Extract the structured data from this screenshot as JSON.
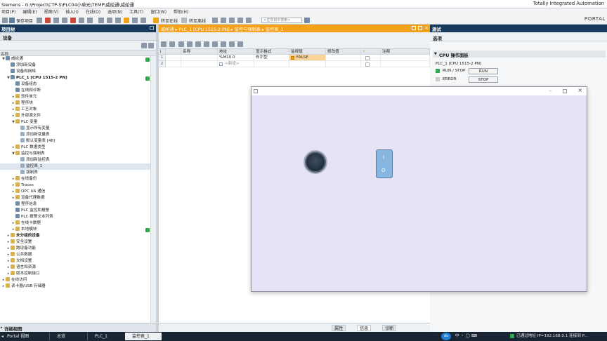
{
  "app": {
    "title": "Siemens  -  G:\\Project\\CTP-S\\PLC04小单元\\TEMP\\威纶通\\威纶通",
    "brand_line1": "Totally Integrated Automation",
    "brand_line2": "PORTAL"
  },
  "menu": [
    "项目(P)",
    "编辑(E)",
    "视图(V)",
    "插入(I)",
    "在线(O)",
    "选项(N)",
    "工具(T)",
    "窗口(W)",
    "帮助(H)"
  ],
  "toolbar": {
    "save_label": "保存项目",
    "go_online": "转至在线",
    "go_offline": "转至离线",
    "search_placeholder": "<在项目中搜索>"
  },
  "left_panel": {
    "title": "项目树",
    "subtitle": "设备",
    "column_name": "名称",
    "tree": [
      {
        "label": "威纶通",
        "indent": 0,
        "twisty": "▼",
        "icon": "project",
        "bold": false
      },
      {
        "label": "添加新设备",
        "indent": 1,
        "twisty": "",
        "icon": "item",
        "bold": false
      },
      {
        "label": "设备和网络",
        "indent": 1,
        "twisty": "",
        "icon": "item",
        "bold": false
      },
      {
        "label": "PLC_1 [CPU 1515-2 PN]",
        "indent": 1,
        "twisty": "▼",
        "icon": "cpu",
        "bold": true
      },
      {
        "label": "设备组态",
        "indent": 2,
        "twisty": "",
        "icon": "item",
        "bold": false
      },
      {
        "label": "在线和诊断",
        "indent": 2,
        "twisty": "",
        "icon": "item",
        "bold": false
      },
      {
        "label": "软件单元",
        "indent": 2,
        "twisty": "▸",
        "icon": "folder",
        "bold": false
      },
      {
        "label": "程序块",
        "indent": 2,
        "twisty": "▸",
        "icon": "folder",
        "bold": false
      },
      {
        "label": "工艺对象",
        "indent": 2,
        "twisty": "▸",
        "icon": "folder",
        "bold": false
      },
      {
        "label": "外部源文件",
        "indent": 2,
        "twisty": "▸",
        "icon": "folder",
        "bold": false
      },
      {
        "label": "PLC 变量",
        "indent": 2,
        "twisty": "▼",
        "icon": "folder",
        "bold": false
      },
      {
        "label": "显示所有变量",
        "indent": 3,
        "twisty": "",
        "icon": "doc",
        "bold": false
      },
      {
        "label": "添加新变量表",
        "indent": 3,
        "twisty": "",
        "icon": "doc",
        "bold": false
      },
      {
        "label": "默认变量表 [48]",
        "indent": 3,
        "twisty": "",
        "icon": "doc",
        "bold": false
      },
      {
        "label": "PLC 数据类型",
        "indent": 2,
        "twisty": "▸",
        "icon": "folder",
        "bold": false
      },
      {
        "label": "监控与强制表",
        "indent": 2,
        "twisty": "▼",
        "icon": "folder",
        "bold": false
      },
      {
        "label": "添加新监控表",
        "indent": 3,
        "twisty": "",
        "icon": "doc",
        "bold": false
      },
      {
        "label": "监控表_1",
        "indent": 3,
        "twisty": "",
        "icon": "doc",
        "bold": false,
        "selected": true
      },
      {
        "label": "强制表",
        "indent": 3,
        "twisty": "",
        "icon": "doc",
        "bold": false
      },
      {
        "label": "在线备份",
        "indent": 2,
        "twisty": "▸",
        "icon": "folder",
        "bold": false
      },
      {
        "label": "Traces",
        "indent": 2,
        "twisty": "▸",
        "icon": "folder",
        "bold": false
      },
      {
        "label": "OPC UA 通信",
        "indent": 2,
        "twisty": "▸",
        "icon": "folder",
        "bold": false
      },
      {
        "label": "设备代理数据",
        "indent": 2,
        "twisty": "▸",
        "icon": "folder",
        "bold": false
      },
      {
        "label": "程序信息",
        "indent": 2,
        "twisty": "",
        "icon": "item",
        "bold": false
      },
      {
        "label": "PLC 监控和报警",
        "indent": 2,
        "twisty": "",
        "icon": "item",
        "bold": false
      },
      {
        "label": "PLC 报警文本列表",
        "indent": 2,
        "twisty": "",
        "icon": "item",
        "bold": false
      },
      {
        "label": "在线卡数据",
        "indent": 2,
        "twisty": "▸",
        "icon": "folder",
        "bold": false
      },
      {
        "label": "本地模块",
        "indent": 2,
        "twisty": "▸",
        "icon": "folder",
        "bold": false
      },
      {
        "label": "未分组的设备",
        "indent": 1,
        "twisty": "▸",
        "icon": "folder",
        "bold": true
      },
      {
        "label": "安全设置",
        "indent": 1,
        "twisty": "▸",
        "icon": "folder",
        "bold": false
      },
      {
        "label": "跨设备功能",
        "indent": 1,
        "twisty": "▸",
        "icon": "folder",
        "bold": false
      },
      {
        "label": "公共数据",
        "indent": 1,
        "twisty": "▸",
        "icon": "folder",
        "bold": false
      },
      {
        "label": "文档设置",
        "indent": 1,
        "twisty": "▸",
        "icon": "folder",
        "bold": false
      },
      {
        "label": "语言和资源",
        "indent": 1,
        "twisty": "▸",
        "icon": "folder",
        "bold": false
      },
      {
        "label": "版本控制接口",
        "indent": 1,
        "twisty": "▸",
        "icon": "folder",
        "bold": false
      },
      {
        "label": "在线访问",
        "indent": 0,
        "twisty": "▸",
        "icon": "folder",
        "bold": false
      },
      {
        "label": "读卡器/USB 存储器",
        "indent": 0,
        "twisty": "▸",
        "icon": "folder",
        "bold": false
      }
    ],
    "details_title": "详细视图"
  },
  "editor": {
    "breadcrumb": "威纶通 ▸ PLC_1 [CPU 1515-2 PN] ▸ 监控与强制表 ▸ 监控表_1",
    "columns": [
      "i",
      "名称",
      "地址",
      "显示格式",
      "监视值",
      "修改值",
      "",
      "注释"
    ],
    "rows": [
      {
        "num": "1",
        "name": "",
        "address": "%M10.0",
        "format": "布尔型",
        "monitor": "FALSE",
        "modify": "",
        "comment": ""
      },
      {
        "num": "2",
        "name": "",
        "address": "<新增>",
        "format": "",
        "monitor": "",
        "modify": "",
        "comment": ""
      }
    ],
    "bottom_tabs": [
      "属性",
      "信息",
      "诊断"
    ]
  },
  "right_panel": {
    "title": "测试",
    "subtitle": "选项",
    "cpu_panel_title": "CPU 操作面板",
    "plc_name": "PLC_1 [CPU 1515-2 PN]",
    "run_stop_label": "RUN / STOP",
    "error_label": "ERROR",
    "run_button": "RUN",
    "stop_button": "STOP"
  },
  "statusbar": {
    "portal_view": "Portal 视图",
    "tabs": [
      "总览",
      "PLC_1",
      "监控表_1"
    ],
    "connection_text": "已通过地址 IP=192.168.0.1 连接到 P..."
  },
  "sim_window": {
    "switch_on": "I",
    "switch_off": "O"
  },
  "colors": {
    "accent_orange": "#f4a11a",
    "dark_blue": "#173a5c",
    "status_green": "#2fa84f"
  }
}
